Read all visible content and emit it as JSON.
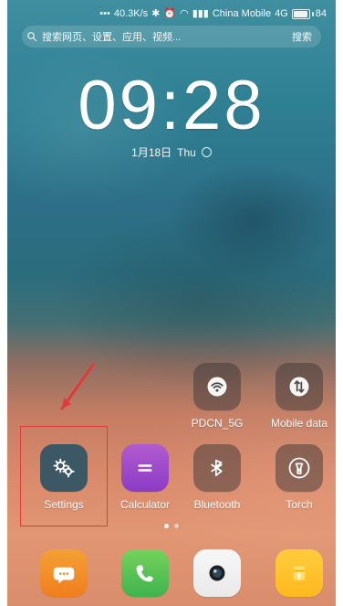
{
  "status_bar": {
    "net_speed": "40.3K/s",
    "carrier": "China Mobile",
    "network": "4G",
    "battery": "84"
  },
  "search": {
    "placeholder": "搜索网页、设置、应用、视频...",
    "button": "搜索"
  },
  "lock": {
    "time": "09:28",
    "date": "1月18日",
    "weekday": "Thu"
  },
  "apps_row_quick": [
    {
      "label": "PDCN_5G",
      "icon": "wifi-icon"
    },
    {
      "label": "Mobile data",
      "icon": "mobile-data-icon"
    }
  ],
  "apps_row_main": [
    {
      "label": "Settings",
      "icon": "settings-icon"
    },
    {
      "label": "Calculator",
      "icon": "calculator-icon"
    },
    {
      "label": "Bluetooth",
      "icon": "bluetooth-icon"
    },
    {
      "label": "Torch",
      "icon": "torch-icon"
    }
  ],
  "dock": [
    {
      "icon": "messages-icon"
    },
    {
      "icon": "phone-icon"
    },
    {
      "icon": "camera-icon"
    },
    {
      "icon": "notes-icon"
    }
  ],
  "page_indicator": {
    "count": 2,
    "active": 0
  },
  "colors": {
    "highlight": "#e23a3a",
    "settings": "#3c5864",
    "calculator": "#8b3cc4"
  }
}
